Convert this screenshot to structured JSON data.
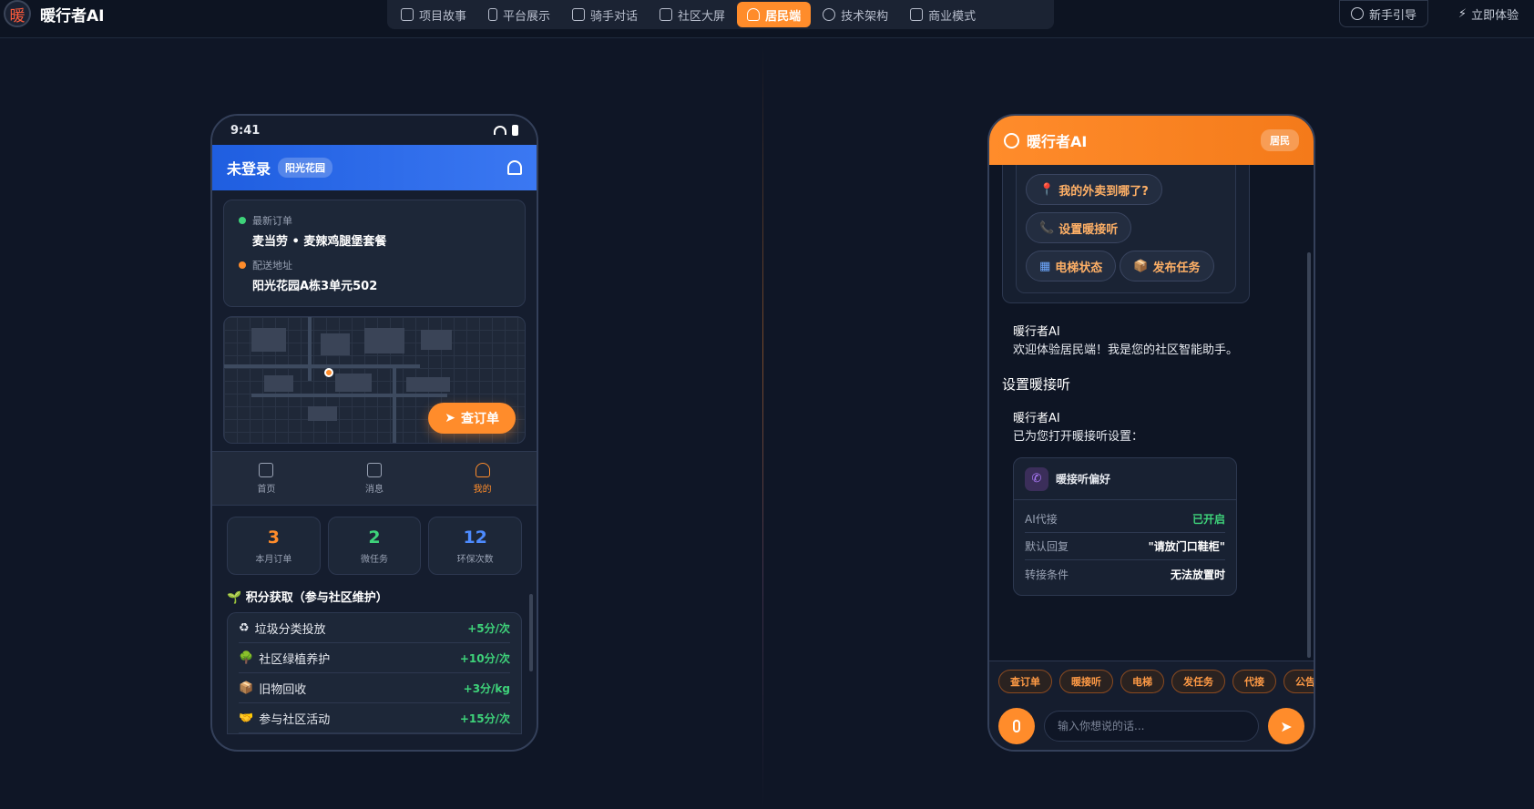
{
  "brand": {
    "logo_char": "暖",
    "name": "暖行者AI"
  },
  "nav": [
    {
      "label": "项目故事",
      "icon": "book-icon"
    },
    {
      "label": "平台展示",
      "icon": "phone-icon"
    },
    {
      "label": "骑手对话",
      "icon": "chat-icon"
    },
    {
      "label": "社区大屏",
      "icon": "grid-icon"
    },
    {
      "label": "居民端",
      "icon": "user-icon",
      "active": true
    },
    {
      "label": "技术架构",
      "icon": "gear-icon"
    },
    {
      "label": "商业模式",
      "icon": "briefcase-icon"
    }
  ],
  "header_actions": {
    "guide": "新手引导",
    "try": "立即体验"
  },
  "phone1": {
    "time": "9:41",
    "title": "未登录",
    "community": "阳光花园",
    "order": {
      "latest_label": "最新订单",
      "latest_value": "麦当劳 • 麦辣鸡腿堡套餐",
      "address_label": "配送地址",
      "address_value": "阳光花园A栋3单元502"
    },
    "map_button": "查订单",
    "tabs": [
      {
        "label": "首页",
        "icon": "home-icon"
      },
      {
        "label": "消息",
        "icon": "message-icon"
      },
      {
        "label": "我的",
        "icon": "profile-icon",
        "active": true
      }
    ],
    "stats": [
      {
        "value": "3",
        "label": "本月订单",
        "color": "#ff8c2b"
      },
      {
        "value": "2",
        "label": "微任务",
        "color": "#3ed37a"
      },
      {
        "value": "12",
        "label": "环保次数",
        "color": "#4d8bff"
      }
    ],
    "points_title": "🌱 积分获取（参与社区维护）",
    "points": [
      {
        "icon": "♻",
        "name": "垃圾分类投放",
        "value": "+5分/次",
        "color": "#3ed37a"
      },
      {
        "icon": "🌳",
        "name": "社区绿植养护",
        "value": "+10分/次",
        "color": "#3ed37a"
      },
      {
        "icon": "📦",
        "name": "旧物回收",
        "value": "+3分/kg",
        "color": "#e0a060"
      },
      {
        "icon": "🤝",
        "name": "参与社区活动",
        "value": "+15分/次",
        "color": "#f3c142"
      }
    ]
  },
  "phone2": {
    "title": "暖行者AI",
    "role": "居民",
    "suggestions": [
      {
        "icon": "📍",
        "label": "我的外卖到哪了?"
      },
      {
        "icon": "📞",
        "label": "设置暖接听"
      },
      {
        "icon": "▦",
        "label": "电梯状态"
      },
      {
        "icon": "📦",
        "label": "发布任务"
      }
    ],
    "welcome": {
      "from": "暖行者AI",
      "text": "欢迎体验居民端！我是您的社区智能助手。"
    },
    "user_message": "设置暖接听",
    "reply": {
      "from": "暖行者AI",
      "text": "已为您打开暖接听设置："
    },
    "card": {
      "title": "暖接听偏好",
      "rows": [
        {
          "label": "AI代接",
          "value": "已开启",
          "color": "#3ed37a"
        },
        {
          "label": "默认回复",
          "value": "\"请放门口鞋柜\"",
          "color": "#ffffff"
        },
        {
          "label": "转接条件",
          "value": "无法放置时",
          "color": "#ffffff"
        }
      ]
    },
    "quick_actions": [
      "查订单",
      "暖接听",
      "电梯",
      "发任务",
      "代接",
      "公告"
    ],
    "input_placeholder": "输入你想说的话..."
  }
}
